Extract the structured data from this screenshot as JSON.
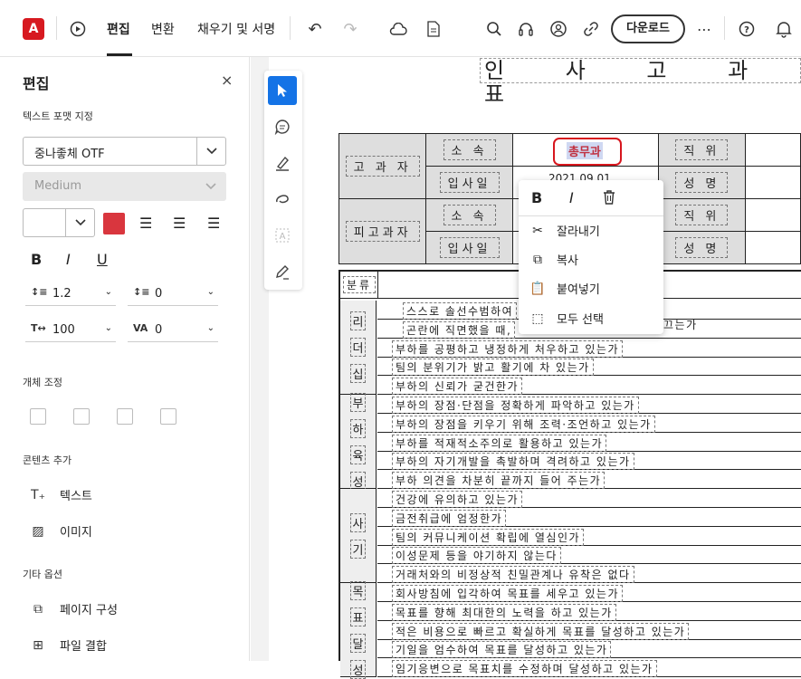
{
  "toolbar": {
    "tabs": [
      "편집",
      "변환",
      "채우기 및 서명"
    ],
    "download_label": "다운로드",
    "more_label": "⋯"
  },
  "left_panel": {
    "title": "편집",
    "close": "×",
    "text_format_section": "텍스트 포맷 지정",
    "font_family": "중나좋체 OTF",
    "font_weight": "Medium",
    "line_spacing": "1.2",
    "para_spacing": "0",
    "horiz_scale": "100",
    "char_spacing": "0",
    "object_section": "개체 조정",
    "add_content_section": "콘텐츠 추가",
    "add_text": "텍스트",
    "add_image": "이미지",
    "other_section": "기타 옵션",
    "page_organize": "페이지 구성",
    "combine_files": "파일 결합",
    "swatch_color": "#d9363e"
  },
  "document": {
    "title": "인 사 고 과 표",
    "header_rows": {
      "rater_label": "고 과 자",
      "ratee_label": "피고과자",
      "dept": "소 속",
      "join_date": "입사일",
      "position": "직 위",
      "name": "성 명",
      "selected_value": "총무과",
      "date_fragment": "2021.09.01"
    },
    "category_header": "분류",
    "categories": [
      {
        "label": [
          "리",
          "더",
          "십"
        ],
        "items": [
          "스스로 솔선수범하여",
          "곤란에 직면했을 때,",
          "부하를 공평하고 냉정하게 처우하고 있는가",
          "팀의 분위기가 밝고 활기에 차 있는가",
          "부하의 신뢰가 굳건한가"
        ]
      },
      {
        "label": [
          "부",
          "하",
          "육",
          "성"
        ],
        "items": [
          "부하의 장점·단점을 정확하게 파악하고 있는가",
          "부하의 장점을 키우기 위해 조력·조언하고 있는가",
          "부하를 적재적소주의로 활용하고 있는가",
          "부하의 자기개발을 촉발하며 격려하고 있는가",
          "부하 의견을 차분히 끝까지 들어 주는가"
        ]
      },
      {
        "label": [
          "사",
          "기"
        ],
        "items": [
          "건강에 유의하고 있는가",
          "금전취급에 엄정한가",
          "팀의 커뮤니케이션 확립에 열심인가",
          "이성문제 등을 야기하지 않는다",
          "거래처와의 비정상적 친밀관계나 유착은 없다"
        ]
      },
      {
        "label": [
          "목",
          "표",
          "달",
          "성"
        ],
        "items": [
          "회사방침에 입각하여 목표를 세우고 있는가",
          "목표를 향해 최대한의 노력을 하고 있는가",
          "적은 비용으로 빠르고 확실하게 목표를 달성하고 있는가",
          "기일을 엄수하여 목표를 달성하고 있는가",
          "임기응변으로 목표치를 수정하며 달성하고 있는가"
        ]
      }
    ],
    "row2_tail": "끄는가"
  },
  "context_menu": {
    "bold": "B",
    "italic": "I",
    "cut": "잘라내기",
    "copy": "복사",
    "paste": "붙여넣기",
    "select_all": "모두 선택"
  }
}
